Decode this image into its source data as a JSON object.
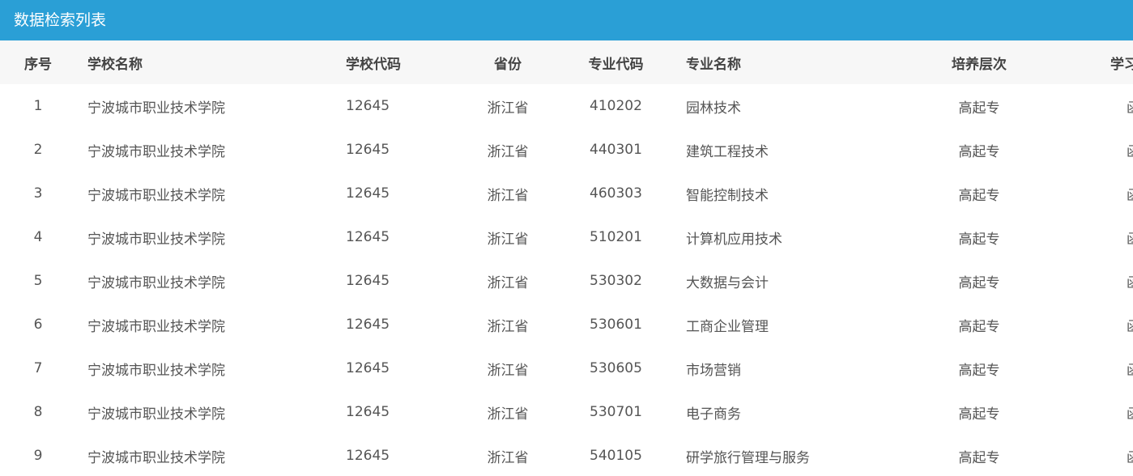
{
  "panel": {
    "title": "数据检索列表"
  },
  "table": {
    "columns": [
      "序号",
      "学校名称",
      "学校代码",
      "省份",
      "专业代码",
      "专业名称",
      "培养层次",
      "学习形式"
    ],
    "rows": [
      [
        "1",
        "宁波城市职业技术学院",
        "12645",
        "浙江省",
        "410202",
        "园林技术",
        "高起专",
        "函授"
      ],
      [
        "2",
        "宁波城市职业技术学院",
        "12645",
        "浙江省",
        "440301",
        "建筑工程技术",
        "高起专",
        "函授"
      ],
      [
        "3",
        "宁波城市职业技术学院",
        "12645",
        "浙江省",
        "460303",
        "智能控制技术",
        "高起专",
        "函授"
      ],
      [
        "4",
        "宁波城市职业技术学院",
        "12645",
        "浙江省",
        "510201",
        "计算机应用技术",
        "高起专",
        "函授"
      ],
      [
        "5",
        "宁波城市职业技术学院",
        "12645",
        "浙江省",
        "530302",
        "大数据与会计",
        "高起专",
        "函授"
      ],
      [
        "6",
        "宁波城市职业技术学院",
        "12645",
        "浙江省",
        "530601",
        "工商企业管理",
        "高起专",
        "函授"
      ],
      [
        "7",
        "宁波城市职业技术学院",
        "12645",
        "浙江省",
        "530605",
        "市场营销",
        "高起专",
        "函授"
      ],
      [
        "8",
        "宁波城市职业技术学院",
        "12645",
        "浙江省",
        "530701",
        "电子商务",
        "高起专",
        "函授"
      ],
      [
        "9",
        "宁波城市职业技术学院",
        "12645",
        "浙江省",
        "540105",
        "研学旅行管理与服务",
        "高起专",
        "函授"
      ]
    ]
  },
  "colors": {
    "header_bg": "#2a9fd6",
    "thead_bg": "#f7f7f7",
    "header_text": "#ffffff",
    "cell_text": "#555555"
  }
}
